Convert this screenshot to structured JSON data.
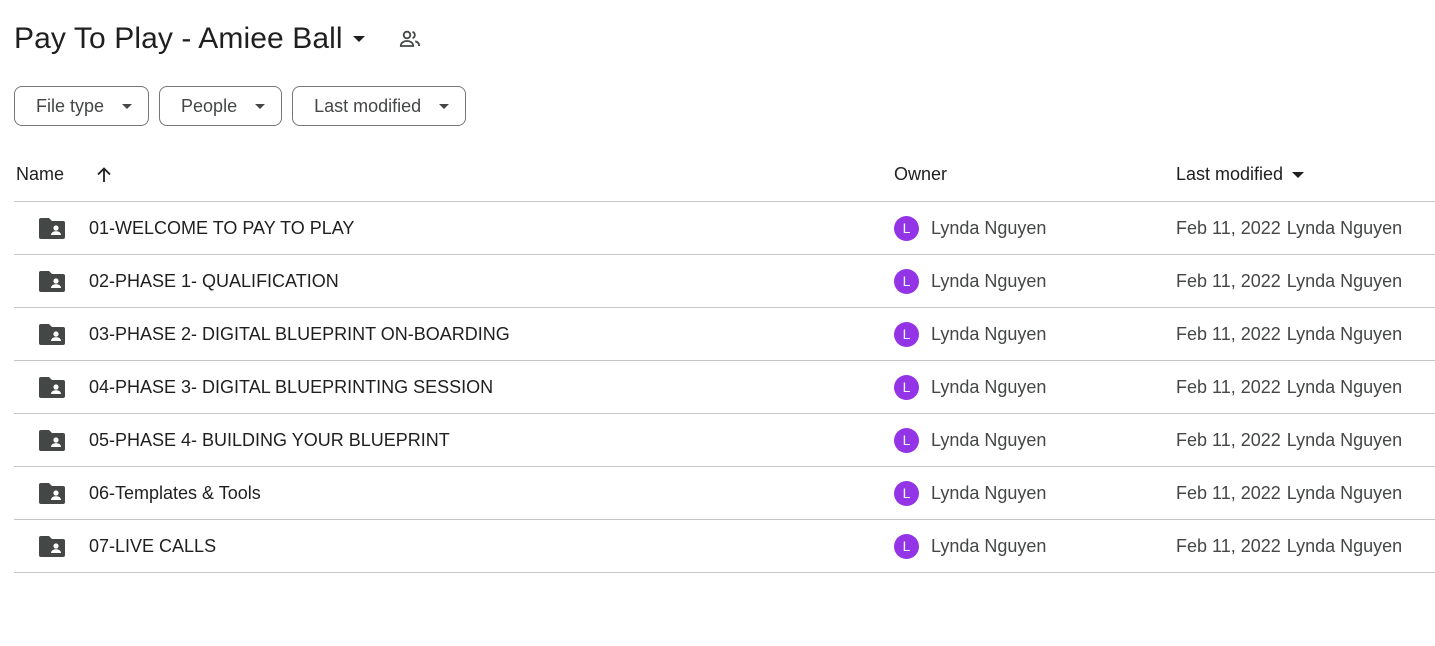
{
  "header": {
    "title": "Pay To Play - Amiee Ball",
    "shared_icon": "people-icon"
  },
  "filters": [
    {
      "label": "File type"
    },
    {
      "label": "People"
    },
    {
      "label": "Last modified"
    }
  ],
  "columns": {
    "name": "Name",
    "owner": "Owner",
    "last_modified": "Last modified"
  },
  "rows": [
    {
      "name": "01-WELCOME TO PAY TO PLAY",
      "owner_initial": "L",
      "owner": "Lynda Nguyen",
      "date": "Feb 11, 2022",
      "modified_by": "Lynda Nguyen"
    },
    {
      "name": "02-PHASE 1- QUALIFICATION",
      "owner_initial": "L",
      "owner": "Lynda Nguyen",
      "date": "Feb 11, 2022",
      "modified_by": "Lynda Nguyen"
    },
    {
      "name": "03-PHASE 2- DIGITAL BLUEPRINT ON-BOARDING",
      "owner_initial": "L",
      "owner": "Lynda Nguyen",
      "date": "Feb 11, 2022",
      "modified_by": "Lynda Nguyen"
    },
    {
      "name": "04-PHASE 3- DIGITAL BLUEPRINTING SESSION",
      "owner_initial": "L",
      "owner": "Lynda Nguyen",
      "date": "Feb 11, 2022",
      "modified_by": "Lynda Nguyen"
    },
    {
      "name": "05-PHASE 4- BUILDING YOUR BLUEPRINT",
      "owner_initial": "L",
      "owner": "Lynda Nguyen",
      "date": "Feb 11, 2022",
      "modified_by": "Lynda Nguyen"
    },
    {
      "name": "06-Templates & Tools",
      "owner_initial": "L",
      "owner": "Lynda Nguyen",
      "date": "Feb 11, 2022",
      "modified_by": "Lynda Nguyen"
    },
    {
      "name": "07-LIVE CALLS",
      "owner_initial": "L",
      "owner": "Lynda Nguyen",
      "date": "Feb 11, 2022",
      "modified_by": "Lynda Nguyen"
    }
  ],
  "colors": {
    "avatar": "#9334e6",
    "divider": "#c7c7c7",
    "folder_icon": "#444746"
  }
}
